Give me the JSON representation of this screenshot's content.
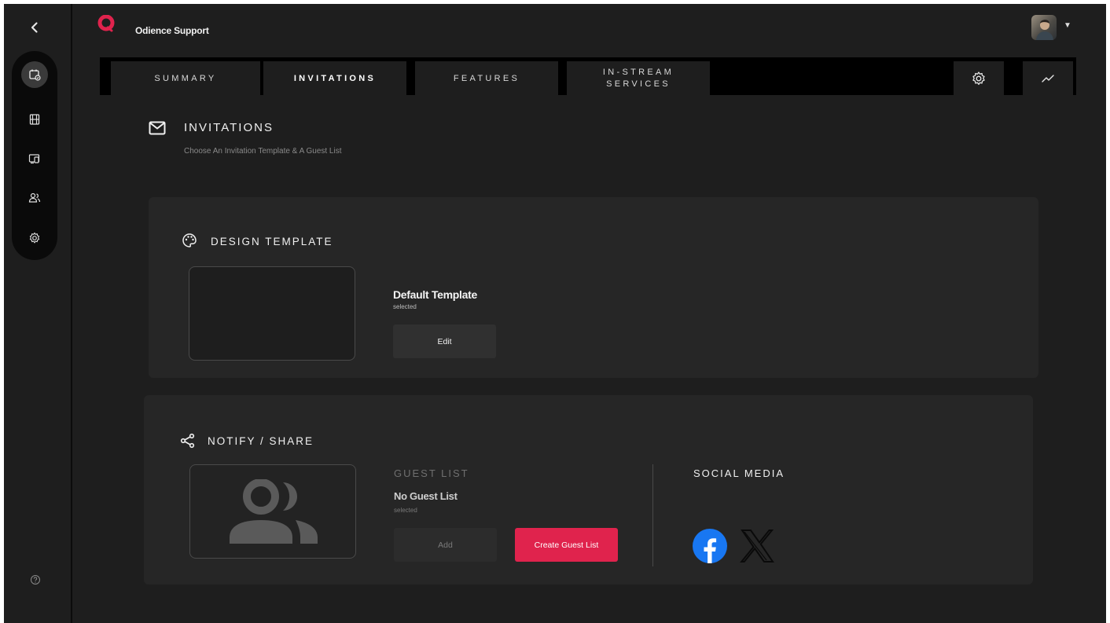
{
  "app": {
    "title": "Odience Support",
    "accent": "#e0234d"
  },
  "rail": {
    "items": [
      {
        "icon": "calendar-check-icon",
        "active": true
      },
      {
        "icon": "film-icon",
        "active": false
      },
      {
        "icon": "devices-icon",
        "active": false
      },
      {
        "icon": "users-icon",
        "active": false
      },
      {
        "icon": "gear-icon",
        "active": false
      }
    ],
    "help_icon": "help-circle-icon"
  },
  "tabs": [
    {
      "label": "SUMMARY",
      "active": false
    },
    {
      "label": "INVITATIONS",
      "active": true
    },
    {
      "label": "FEATURES",
      "active": false
    },
    {
      "label_line1": "IN-STREAM",
      "label_line2": "SERVICES",
      "active": false
    }
  ],
  "tab_icons": [
    "gear-icon",
    "trend-icon"
  ],
  "section": {
    "title": "INVITATIONS",
    "subtitle": "Choose An Invitation Template & A Guest List"
  },
  "design_template": {
    "title": "DESIGN TEMPLATE",
    "template_name": "Default Template",
    "status": "selected",
    "edit_label": "Edit"
  },
  "notify_share": {
    "title": "NOTIFY / SHARE",
    "guest_list": {
      "heading": "GUEST LIST",
      "value": "No Guest List",
      "status": "selected",
      "add_label": "Add",
      "create_label": "Create Guest List"
    },
    "social": {
      "heading": "SOCIAL MEDIA",
      "icons": [
        "facebook-icon",
        "x-icon"
      ]
    }
  }
}
